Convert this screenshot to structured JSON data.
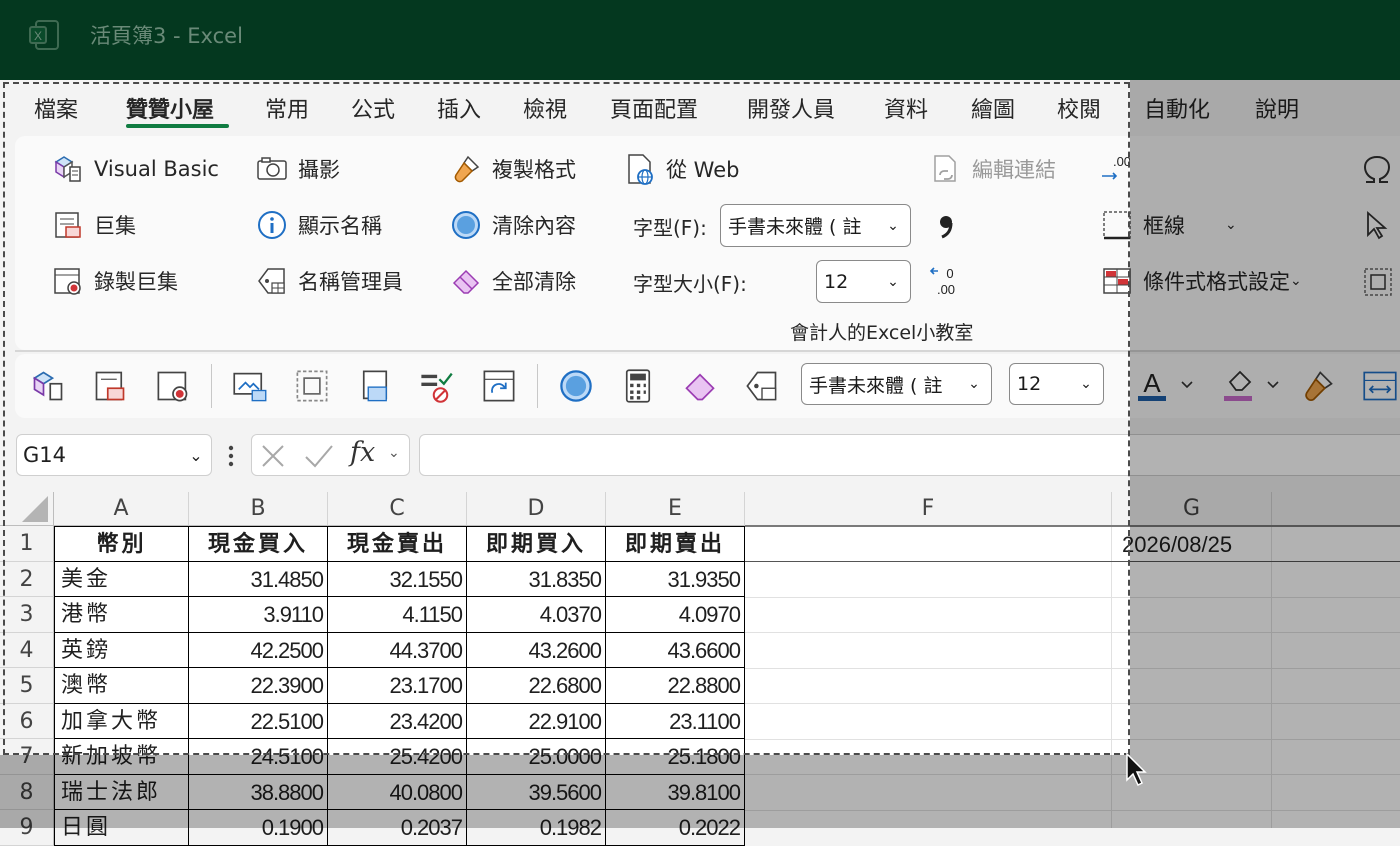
{
  "window": {
    "title": "活頁簿3  -  Excel"
  },
  "tabs": [
    {
      "label": "檔案"
    },
    {
      "label": "贊贊小屋"
    },
    {
      "label": "常用"
    },
    {
      "label": "公式"
    },
    {
      "label": "插入"
    },
    {
      "label": "檢視"
    },
    {
      "label": "頁面配置"
    },
    {
      "label": "開發人員"
    },
    {
      "label": "資料"
    },
    {
      "label": "繪圖"
    },
    {
      "label": "校閱"
    },
    {
      "label": "自動化"
    },
    {
      "label": "說明"
    }
  ],
  "ribbon": {
    "visual_basic": "Visual Basic",
    "macros": "巨集",
    "record_macro": "錄製巨集",
    "camera": "攝影",
    "show_names": "顯示名稱",
    "name_manager": "名稱管理員",
    "format_painter": "複製格式",
    "clear_contents": "清除內容",
    "clear_all": "全部清除",
    "from_web": "從 Web",
    "font_label": "字型(F):",
    "font_value": "手書未來體 ( 註",
    "font_size_label": "字型大小(F):",
    "font_size_value": "12",
    "edit_links": "編輯連結",
    "borders": "框線",
    "conditional_formatting": "條件式格式設定",
    "group_label": "會計人的Excel小教室"
  },
  "qat": {
    "font_value": "手書未來體 ( 註",
    "font_size_value": "12"
  },
  "formula_bar": {
    "name_box": "G14",
    "fx": "fx",
    "formula": ""
  },
  "sheet": {
    "columns": [
      "A",
      "B",
      "C",
      "D",
      "E",
      "F",
      "G"
    ],
    "rows": [
      "1",
      "2",
      "3",
      "4",
      "5",
      "6",
      "7",
      "8",
      "9"
    ],
    "header_row": [
      "幣別",
      "現金買入",
      "現金賣出",
      "即期買入",
      "即期賣出"
    ],
    "data": [
      [
        "美金",
        "31.4850",
        "32.1550",
        "31.8350",
        "31.9350"
      ],
      [
        "港幣",
        "3.9110",
        "4.1150",
        "4.0370",
        "4.0970"
      ],
      [
        "英鎊",
        "42.2500",
        "44.3700",
        "43.2600",
        "43.6600"
      ],
      [
        "澳幣",
        "22.3900",
        "23.1700",
        "22.6800",
        "22.8800"
      ],
      [
        "加拿大幣",
        "22.5100",
        "23.4200",
        "22.9100",
        "23.1100"
      ],
      [
        "新加坡幣",
        "24.5100",
        "25.4200",
        "25.0000",
        "25.1800"
      ],
      [
        "瑞士法郎",
        "38.8800",
        "40.0800",
        "39.5600",
        "39.8100"
      ],
      [
        "日圓",
        "0.1900",
        "0.2037",
        "0.1982",
        "0.2022"
      ]
    ],
    "g1_value": "2026/08/25"
  },
  "colors": {
    "title_bar": "#04381f",
    "accent": "#107c41"
  }
}
